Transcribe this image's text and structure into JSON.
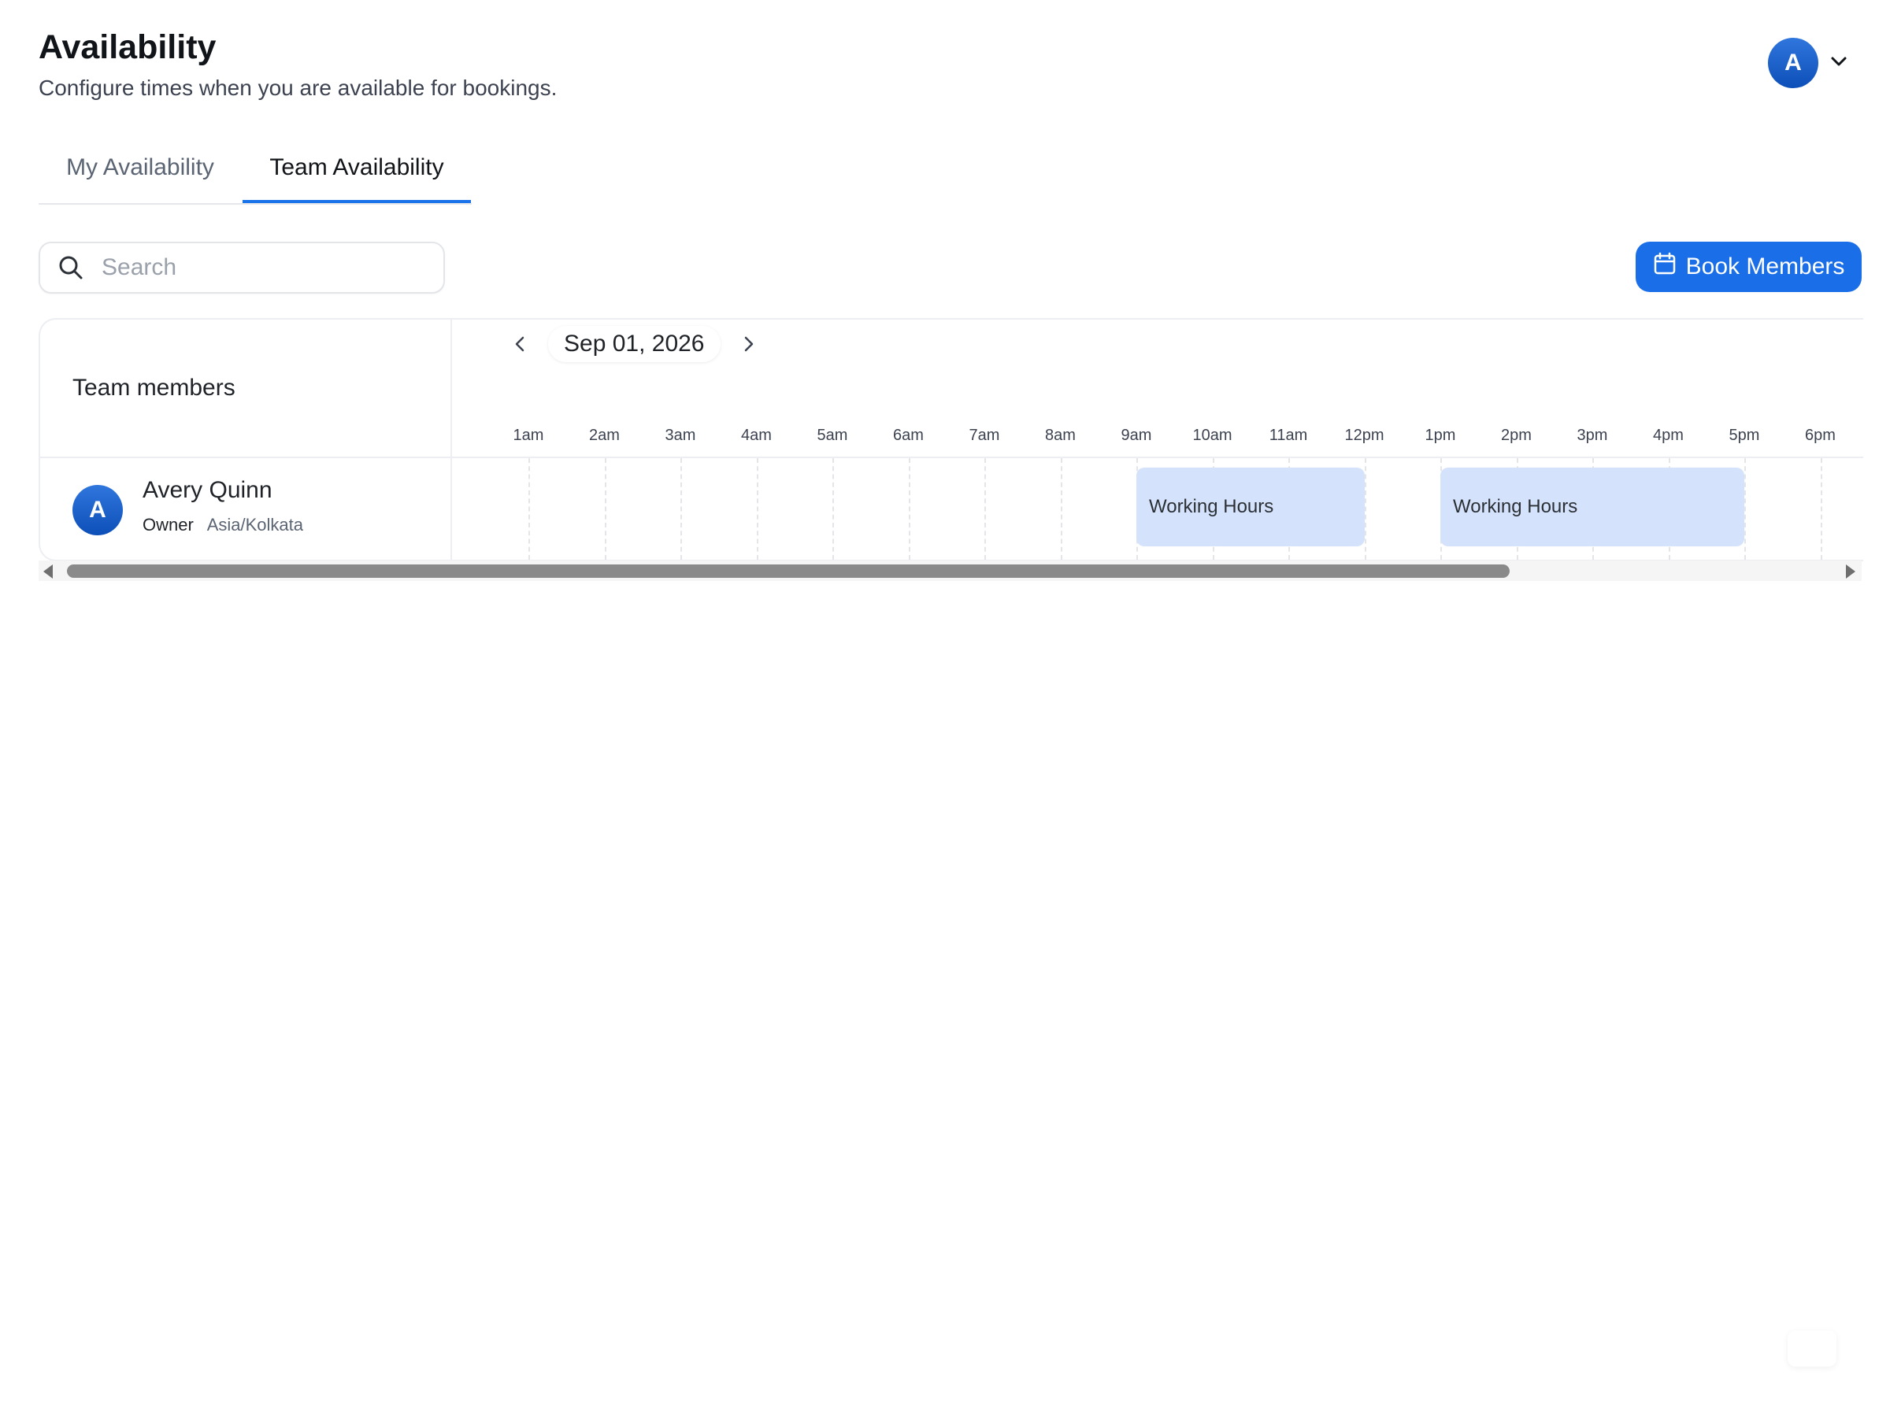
{
  "header": {
    "title": "Availability",
    "subtitle": "Configure times when you are available for bookings."
  },
  "user_menu": {
    "avatar_initial": "A"
  },
  "tabs": [
    {
      "label": "My Availability",
      "active": false
    },
    {
      "label": "Team Availability",
      "active": true
    }
  ],
  "search": {
    "placeholder": "Search",
    "value": ""
  },
  "actions": {
    "book_members_label": "Book Members"
  },
  "grid": {
    "members_header": "Team members",
    "date": "Sep 01, 2026",
    "hours": [
      "1am",
      "2am",
      "3am",
      "4am",
      "5am",
      "6am",
      "7am",
      "8am",
      "9am",
      "10am",
      "11am",
      "12pm",
      "1pm",
      "2pm",
      "3pm",
      "4pm",
      "5pm",
      "6pm"
    ],
    "members": [
      {
        "initial": "A",
        "name": "Avery Quinn",
        "role": "Owner",
        "timezone": "Asia/Kolkata",
        "blocks": [
          {
            "label": "Working Hours",
            "start": "9am",
            "end": "12pm"
          },
          {
            "label": "Working Hours",
            "start": "1pm",
            "end": "5pm"
          }
        ]
      }
    ]
  },
  "colors": {
    "accent": "#1a6fe8",
    "working_block": "#d4e3fb",
    "avatar": "#1a5fcf"
  }
}
